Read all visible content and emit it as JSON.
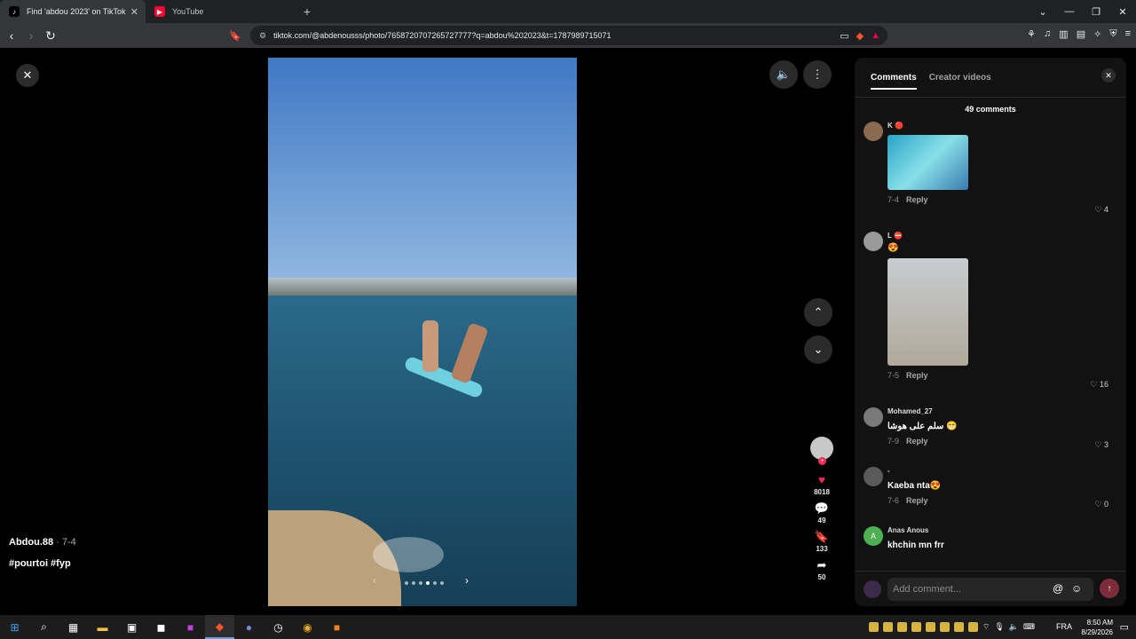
{
  "browser": {
    "tabs": [
      {
        "title": "Find 'abdou 2023' on TikTok",
        "active": true
      },
      {
        "title": "YouTube",
        "active": false
      }
    ],
    "new_tab": "+",
    "window_controls": [
      "⌄",
      "—",
      "❐",
      "✕"
    ],
    "url": "tiktok.com/@abdenousss/photo/7658720707265727777?q=abdou%202023&t=1787989715071"
  },
  "viewer": {
    "close_icon": "✕",
    "volume_icon": "🔈",
    "more_icon": "⋮",
    "up_icon": "⌃",
    "down_icon": "⌄",
    "author": "Abdou.88",
    "post_date": " · 7-4",
    "hashtags": "#pourtoi #fyp",
    "likes": "8018",
    "comments": "49",
    "saves": "133",
    "shares": "50"
  },
  "panel": {
    "tab_comments": "Comments",
    "tab_creator": "Creator videos",
    "close": "✕",
    "total": "49 comments",
    "comments": [
      {
        "user": "K 🔴",
        "text": "",
        "date": "7-4",
        "reply": "Reply",
        "likes": "4",
        "has_image": true
      },
      {
        "user": "L ⛔",
        "text": "😍",
        "date": "7-5",
        "reply": "Reply",
        "likes": "16",
        "has_image": true
      },
      {
        "user": "Mohamed_27",
        "text": "سلم على هوشا 😁",
        "date": "7-9",
        "reply": "Reply",
        "likes": "3"
      },
      {
        "user": "-",
        "text": "Kaeba nta😍",
        "date": "7-6",
        "reply": "Reply",
        "likes": "0"
      },
      {
        "user": "Anas Anous",
        "text": "khchin mn frr",
        "date": "",
        "reply": "",
        "likes": "",
        "avatar_letter": "A"
      }
    ],
    "add_comment_placeholder": "Add comment...",
    "at_icon": "@",
    "emoji_icon": "☺",
    "send_icon": "↑"
  },
  "taskbar": {
    "language": "FRA",
    "time": "8:50 AM",
    "date": "8/29/2026"
  },
  "colors": {
    "accent_red": "#fe2c55",
    "panel_bg": "#121212",
    "chrome_dark": "#202124"
  }
}
